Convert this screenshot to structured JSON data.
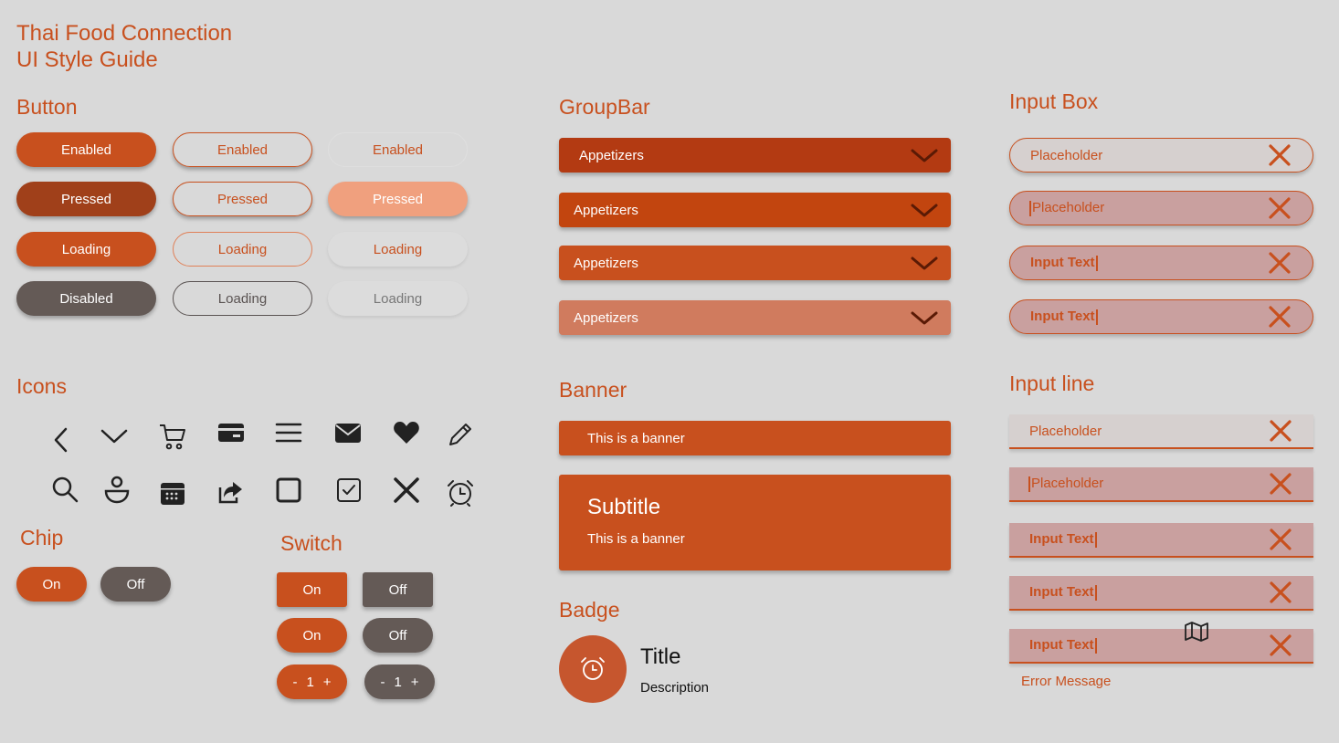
{
  "header": {
    "line1": "Thai Food Connection",
    "line2": "UI Style Guide"
  },
  "sections": {
    "button": "Button",
    "icons": "Icons",
    "chip": "Chip",
    "switch": "Switch",
    "groupbar": "GroupBar",
    "banner": "Banner",
    "badge": "Badge",
    "input_box": "Input Box",
    "input_line": "Input line"
  },
  "buttons": {
    "enabled": "Enabled",
    "pressed": "Pressed",
    "loading": "Loading",
    "disabled": "Disabled"
  },
  "icons": [
    "chevron-left-icon",
    "chevron-down-icon",
    "cart-icon",
    "credit-card-icon",
    "menu-icon",
    "mail-icon",
    "heart-icon",
    "pencil-icon",
    "search-icon",
    "user-icon",
    "calendar-icon",
    "share-icon",
    "checkbox-empty-icon",
    "checkbox-checked-icon",
    "close-icon",
    "alarm-icon"
  ],
  "chip": {
    "on": "On",
    "off": "Off"
  },
  "switch": {
    "on": "On",
    "off": "Off",
    "minus": "-",
    "value": "1",
    "plus": "+"
  },
  "groupbar": {
    "label": "Appetizers"
  },
  "banner": {
    "text": "This is a banner",
    "subtitle": "Subtitle"
  },
  "badge": {
    "title": "Title",
    "description": "Description"
  },
  "input": {
    "placeholder": "Placeholder",
    "value": "Input Text",
    "error": "Error Message"
  },
  "colors": {
    "accent": "#c8501e",
    "pressed": "#a0401a",
    "dark": "#645a56",
    "groupbar_1": "#b33a12",
    "groupbar_2": "#c2450f",
    "groupbar_3": "#c8501e",
    "groupbar_4": "#d07b5e"
  }
}
